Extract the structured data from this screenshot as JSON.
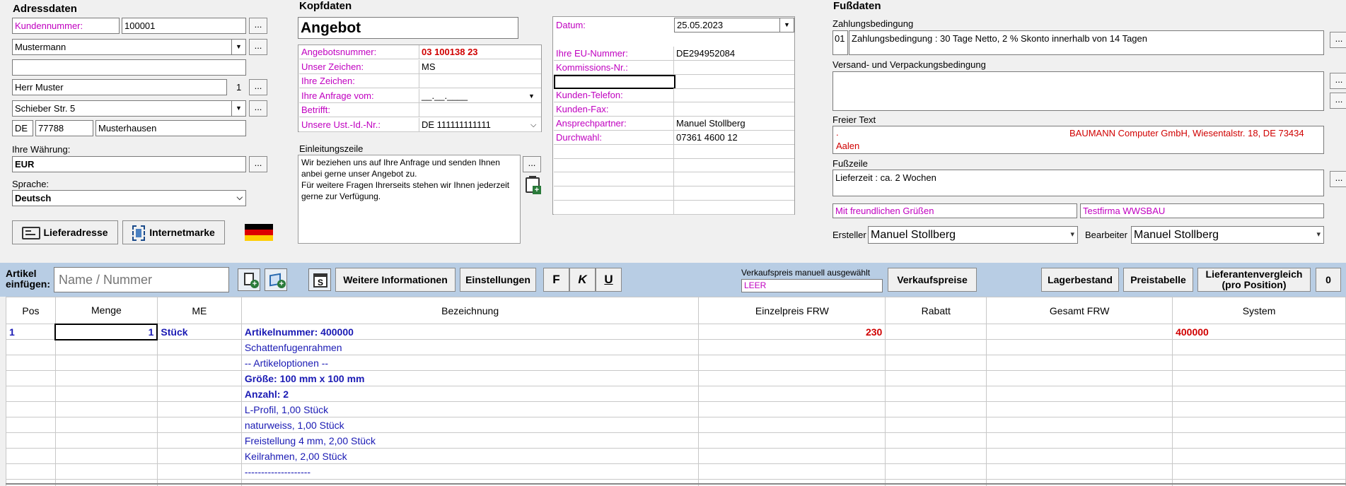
{
  "address": {
    "title": "Adressdaten",
    "customer_number_label": "Kundennummer:",
    "customer_number": "100001",
    "name": "Mustermann",
    "line2": "",
    "contact": "Herr Muster",
    "contact_count": "1",
    "street": "Schieber Str. 5",
    "country": "DE",
    "zip": "77788",
    "city": "Musterhausen",
    "currency_label": "Ihre Währung:",
    "currency": "EUR",
    "language_label": "Sprache:",
    "language": "Deutsch",
    "delivery_button": "Lieferadresse",
    "internet_button": "Internetmarke",
    "dots": "..."
  },
  "header": {
    "title": "Kopfdaten",
    "doc_type": "Angebot",
    "fields": [
      {
        "label": "Angebotsnummer:",
        "value": "03 100138 23"
      },
      {
        "label": "Unser Zeichen:",
        "value": "MS"
      },
      {
        "label": "Ihre Zeichen:",
        "value": ""
      },
      {
        "label": "Ihre Anfrage vom:",
        "value": "__.__.____"
      },
      {
        "label": "Betrifft:",
        "value": ""
      },
      {
        "label": "Unsere Ust.-Id.-Nr.:",
        "value": "DE 111111111111"
      }
    ],
    "intro_label": "Einleitungszeile",
    "intro_text": "Wir beziehen uns auf Ihre Anfrage und senden Ihnen anbei gerne unser Angebot zu.\nFür weitere Fragen Ihrerseits stehen wir Ihnen jederzeit gerne zur Verfügung.",
    "date_label": "Datum:",
    "date": "25.05.2023",
    "right_fields": [
      {
        "label": "Ihre EU-Nummer:",
        "value": "DE294952084"
      },
      {
        "label": "Kommissions-Nr.:",
        "value": ""
      },
      {
        "label": "",
        "value": ""
      },
      {
        "label": "Kunden-Telefon:",
        "value": ""
      },
      {
        "label": "Kunden-Fax:",
        "value": ""
      },
      {
        "label": "Ansprechpartner:",
        "value": "Manuel Stollberg"
      },
      {
        "label": "Durchwahl:",
        "value": "07361 4600 12"
      }
    ]
  },
  "footer": {
    "title": "Fußdaten",
    "payment_label": "Zahlungsbedingung",
    "payment_code": "01",
    "payment_text": "Zahlungsbedingung : 30 Tage Netto, 2 % Skonto innerhalb von 14 Tagen",
    "shipping_label": "Versand- und Verpackungsbedingung",
    "free_text_label": "Freier Text",
    "free_text_dot": ".",
    "free_text_company": "BAUMANN Computer GmbH, Wiesentalstr. 18, DE 73434",
    "free_text_city": "Aalen",
    "footer_line_label": "Fußzeile",
    "footer_line": "Lieferzeit : ca. 2 Wochen",
    "greeting": "Mit freundlichen Grüßen",
    "company": "Testfirma WWSBAU",
    "creator_label": "Ersteller",
    "creator": "Manuel Stollberg",
    "editor_label": "Bearbeiter",
    "editor": "Manuel Stollberg"
  },
  "toolbar": {
    "insert_label": "Artikel einfügen:",
    "insert_label_1": "Artikel",
    "insert_label_2": "einfügen:",
    "search_placeholder": "Name / Nummer",
    "more_info": "Weitere Informationen",
    "settings": "Einstellungen",
    "bold": "F",
    "italic": "K",
    "underline": "U",
    "price_manual_label": "Verkaufspreis manuell ausgewählt",
    "price_manual_value": "LEER",
    "sales_prices": "Verkaufspreise",
    "stock": "Lagerbestand",
    "price_table": "Preistabelle",
    "supplier_compare_1": "Lieferantenvergleich",
    "supplier_compare_2": "(pro Position)",
    "zero": "0"
  },
  "grid": {
    "columns": [
      "Pos",
      "Menge",
      "ME",
      "Bezeichnung",
      "Einzelpreis FRW",
      "Rabatt",
      "Gesamt FRW",
      "System"
    ],
    "rows": [
      {
        "pos": "1",
        "menge": "1",
        "me": "Stück",
        "bez": "Artikelnummer: 400000",
        "preis": "230",
        "rabatt": "",
        "gesamt": "",
        "system": "400000",
        "bold": true
      },
      {
        "pos": "",
        "menge": "",
        "me": "",
        "bez": "Schattenfugenrahmen",
        "preis": "",
        "rabatt": "",
        "gesamt": "",
        "system": "",
        "bold": false
      },
      {
        "pos": "",
        "menge": "",
        "me": "",
        "bez": "-- Artikeloptionen --",
        "preis": "",
        "rabatt": "",
        "gesamt": "",
        "system": "",
        "bold": false
      },
      {
        "pos": "",
        "menge": "",
        "me": "",
        "bez": "Größe: 100 mm x 100 mm",
        "preis": "",
        "rabatt": "",
        "gesamt": "",
        "system": "",
        "bold": true
      },
      {
        "pos": "",
        "menge": "",
        "me": "",
        "bez": "Anzahl: 2",
        "preis": "",
        "rabatt": "",
        "gesamt": "",
        "system": "",
        "bold": true
      },
      {
        "pos": "",
        "menge": "",
        "me": "",
        "bez": "L-Profil, 1,00 Stück",
        "preis": "",
        "rabatt": "",
        "gesamt": "",
        "system": "",
        "bold": false
      },
      {
        "pos": "",
        "menge": "",
        "me": "",
        "bez": "naturweiss, 1,00 Stück",
        "preis": "",
        "rabatt": "",
        "gesamt": "",
        "system": "",
        "bold": false
      },
      {
        "pos": "",
        "menge": "",
        "me": "",
        "bez": "Freistellung 4 mm, 2,00 Stück",
        "preis": "",
        "rabatt": "",
        "gesamt": "",
        "system": "",
        "bold": false
      },
      {
        "pos": "",
        "menge": "",
        "me": "",
        "bez": "Keilrahmen, 2,00 Stück",
        "preis": "",
        "rabatt": "",
        "gesamt": "",
        "system": "",
        "bold": false
      },
      {
        "pos": "",
        "menge": "",
        "me": "",
        "bez": "--------------------",
        "preis": "",
        "rabatt": "",
        "gesamt": "",
        "system": "",
        "bold": false
      }
    ]
  },
  "colors": {
    "label_pink": "#c000c0",
    "value_red": "#d00000",
    "grid_blue": "#1a1ab4",
    "toolbar_bg": "#b8cde4"
  },
  "icons": {
    "flag": "flag-germany-icon",
    "delivery": "address-card-icon",
    "internet": "stamp-icon"
  }
}
